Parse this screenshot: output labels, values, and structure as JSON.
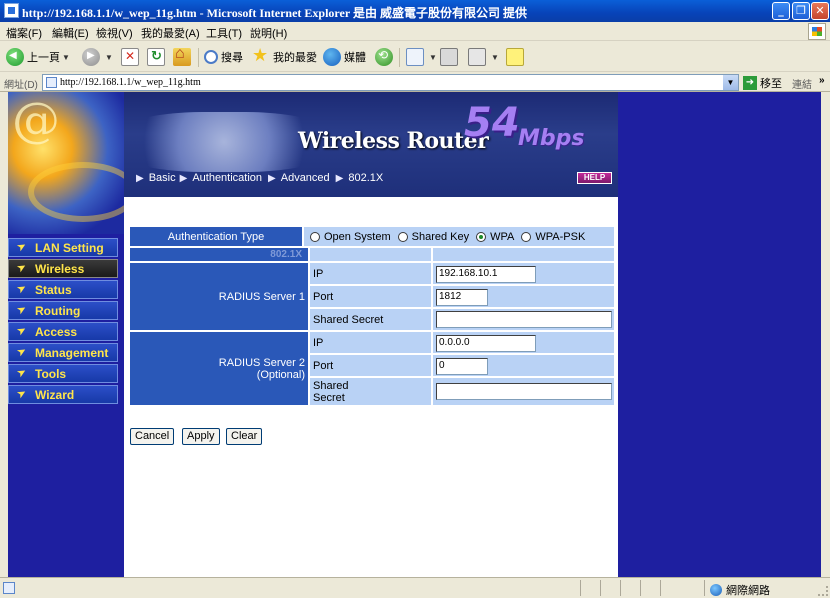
{
  "window": {
    "title": "http://192.168.1.1/w_wep_11g.htm - Microsoft Internet Explorer 是由 威盛電子股份有限公司 提供",
    "minimize": "_",
    "maximize": "❐",
    "close": "✕"
  },
  "menubar": {
    "items": [
      "檔案(F)",
      "編輯(E)",
      "檢視(V)",
      "我的最愛(A)",
      "工具(T)",
      "說明(H)"
    ]
  },
  "toolbar": {
    "back_label": "上一頁",
    "search_label": "搜尋",
    "favorites_label": "我的最愛",
    "media_label": "媒體"
  },
  "addressbar": {
    "label": "網址(D)",
    "url": "http://192.168.1.1/w_wep_11g.htm",
    "go_label": "移至",
    "links_label": "連結",
    "links_more": "»"
  },
  "sidebar": {
    "items": [
      "LAN Setting",
      "Wireless",
      "Status",
      "Routing",
      "Access",
      "Management",
      "Tools",
      "Wizard"
    ],
    "active": "Wireless"
  },
  "header": {
    "brand": "Wireless Router",
    "speed": "54",
    "speed_unit": "Mbps",
    "breadcrumb": [
      "Basic",
      "Authentication",
      "Advanced",
      "802.1X"
    ],
    "help_label": "HELP"
  },
  "form": {
    "auth_type_label": "Authentication Type",
    "auth_options": [
      "Open System",
      "Shared Key",
      "WPA",
      "WPA-PSK"
    ],
    "auth_selected": "WPA",
    "section_label": "802.1X",
    "server1": {
      "label": "RADIUS Server 1",
      "ip_label": "IP",
      "ip_value": "192.168.10.1",
      "port_label": "Port",
      "port_value": "1812",
      "secret_label": "Shared Secret",
      "secret_value": ""
    },
    "server2": {
      "label_line1": "RADIUS Server 2",
      "label_line2": "(Optional)",
      "ip_label": "IP",
      "ip_value": "0.0.0.0",
      "port_label": "Port",
      "port_value": "0",
      "secret_label_line1": "Shared",
      "secret_label_line2": "Secret",
      "secret_value": ""
    },
    "buttons": {
      "cancel": "Cancel",
      "apply": "Apply",
      "clear": "Clear"
    }
  },
  "statusbar": {
    "zone_label": "網際網路"
  },
  "colors": {
    "page_bg": "#1e1fa0",
    "table_header": "#2a58b8",
    "table_light": "#b9d2f5",
    "nav_text": "#ffe54a",
    "speed_purple": "#a57ff2"
  }
}
